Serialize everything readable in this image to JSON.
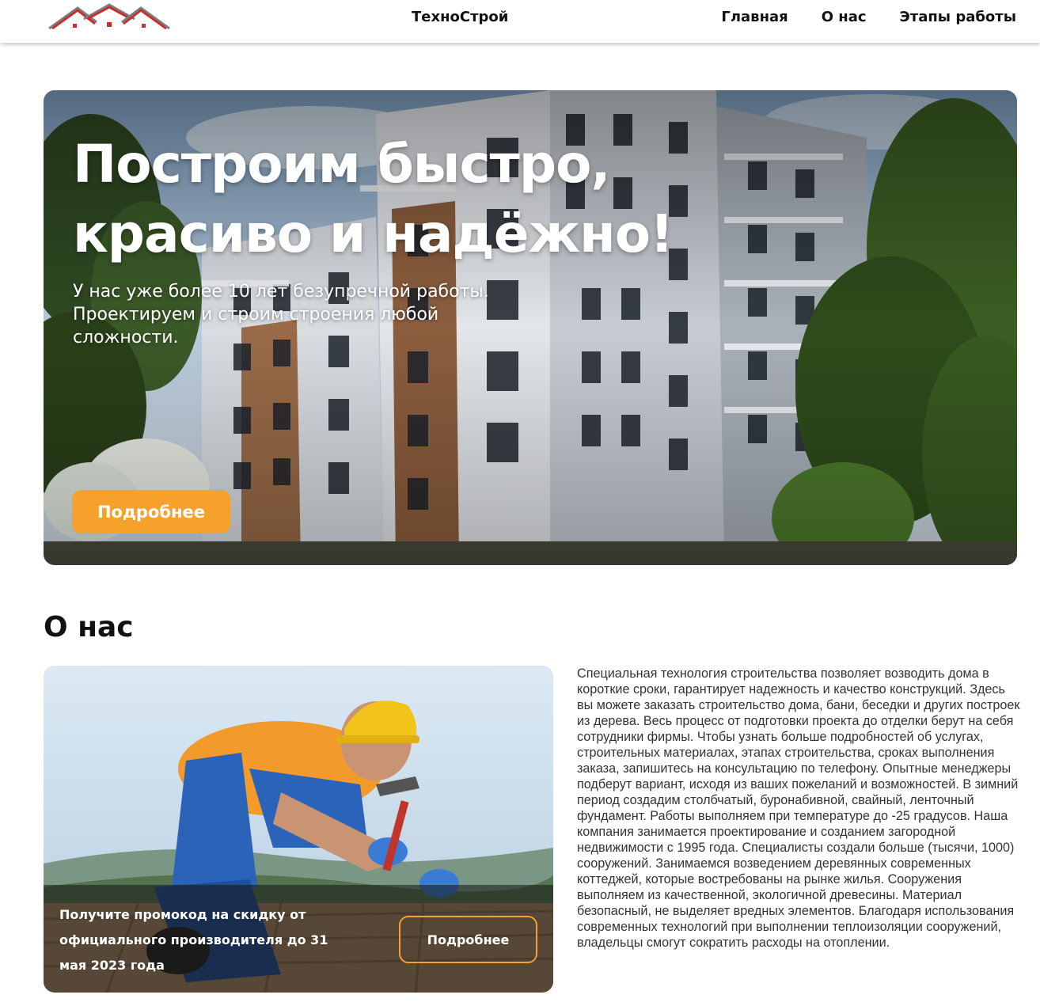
{
  "header": {
    "brand": "ТехноСтрой",
    "nav": [
      "Главная",
      "О нас",
      "Этапы работы"
    ],
    "colors": {
      "roof": "#c8302c",
      "roof_outline": "#7b7f86"
    }
  },
  "hero": {
    "title": "Построим быстро, красиво и надёжно!",
    "subtitle": "У нас уже более 10 лет безупречной работы. Проектируем и строим строения любой сложности.",
    "button_label": "Подробнее",
    "accent": "#f6a12c"
  },
  "about": {
    "title": "О нас",
    "promo_text": "Получите промокод на скидку от официального производителя до 31 мая 2023 года",
    "promo_button": "Подробнее",
    "text": "Специальная технология строительства позволяет возводить дома в короткие сроки, гарантирует надежность и качество конструкций. Здесь вы можете заказать строительство дома, бани, беседки и других построек из дерева. Весь процесс от подготовки проекта до отделки берут на себя сотрудники фирмы. Чтобы узнать больше подробностей об услугах, строительных материалах, этапах строительства, сроках выполнения заказа, запишитесь на консультацию по телефону. Опытные менеджеры подберут вариант, исходя из ваших пожеланий и возможностей. В зимний период создадим столбчатый, буронабивной, свайный, ленточный фундамент. Работы выполняем при температуре до -25 градусов. Наша компания занимается проектирование и созданием загородной недвижимости с 1995 года. Специалисты создали больше (тысячи, 1000) сооружений. Занимаемся возведением деревянных современных коттеджей, которые востребованы на рынке жилья. Сооружения выполняем из качественной, экологичной древесины. Материал безопасный, не выделяет вредных элементов. Благодаря использования современных технологий при выполнении теплоизоляции сооружений, владельцы смогут сократить расходы на отоплении."
  }
}
